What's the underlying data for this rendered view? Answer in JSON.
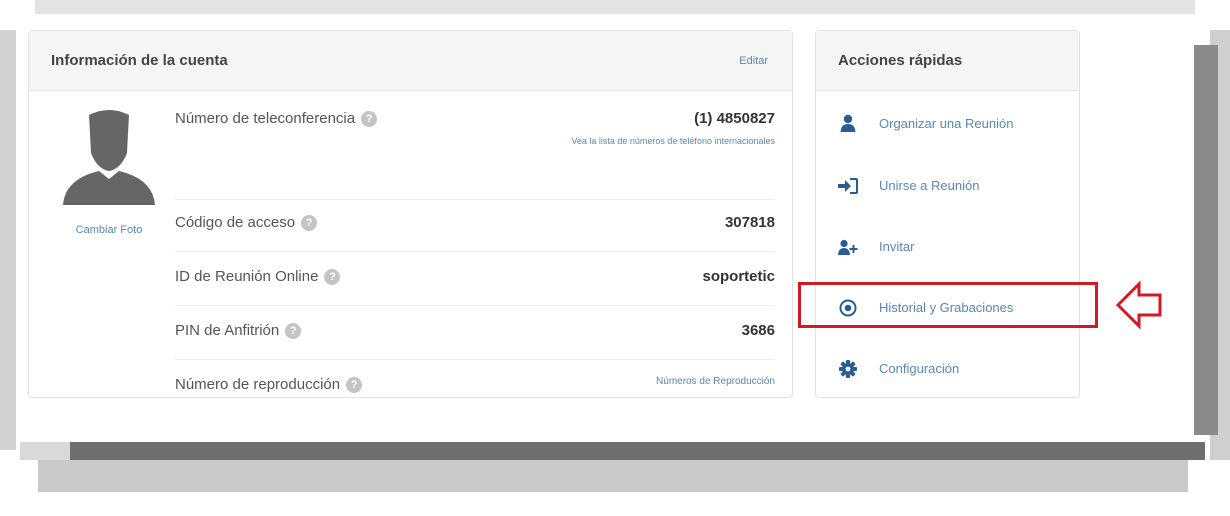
{
  "account": {
    "title": "Información de la cuenta",
    "edit": "Editar",
    "change_photo": "Cambiar Foto",
    "rows": [
      {
        "label": "Número de teleconferencia",
        "value": "(1) 4850827",
        "sub": "Vea la lista de números de teléfono internacionales"
      },
      {
        "label": "Código de acceso",
        "value": "307818"
      },
      {
        "label": "ID de Reunión Online",
        "value": "soportetic"
      },
      {
        "label": "PIN de Anfitrión",
        "value": "3686"
      },
      {
        "label": "Número de reproducción",
        "value": "Números de Reproducción"
      }
    ],
    "help_glyph": "?"
  },
  "quick_actions": {
    "title": "Acciones rápidas",
    "items": [
      {
        "label": "Organizar una Reunión",
        "icon": "user-icon"
      },
      {
        "label": "Unirse a Reunión",
        "icon": "sign-in-icon"
      },
      {
        "label": "Invitar",
        "icon": "user-plus-icon"
      },
      {
        "label": "Historial y Grabaciones",
        "icon": "record-icon"
      },
      {
        "label": "Configuración",
        "icon": "gear-icon"
      }
    ]
  },
  "colors": {
    "link": "#5a86b9",
    "icon": "#2a5d93",
    "highlight": "#d11a23"
  }
}
